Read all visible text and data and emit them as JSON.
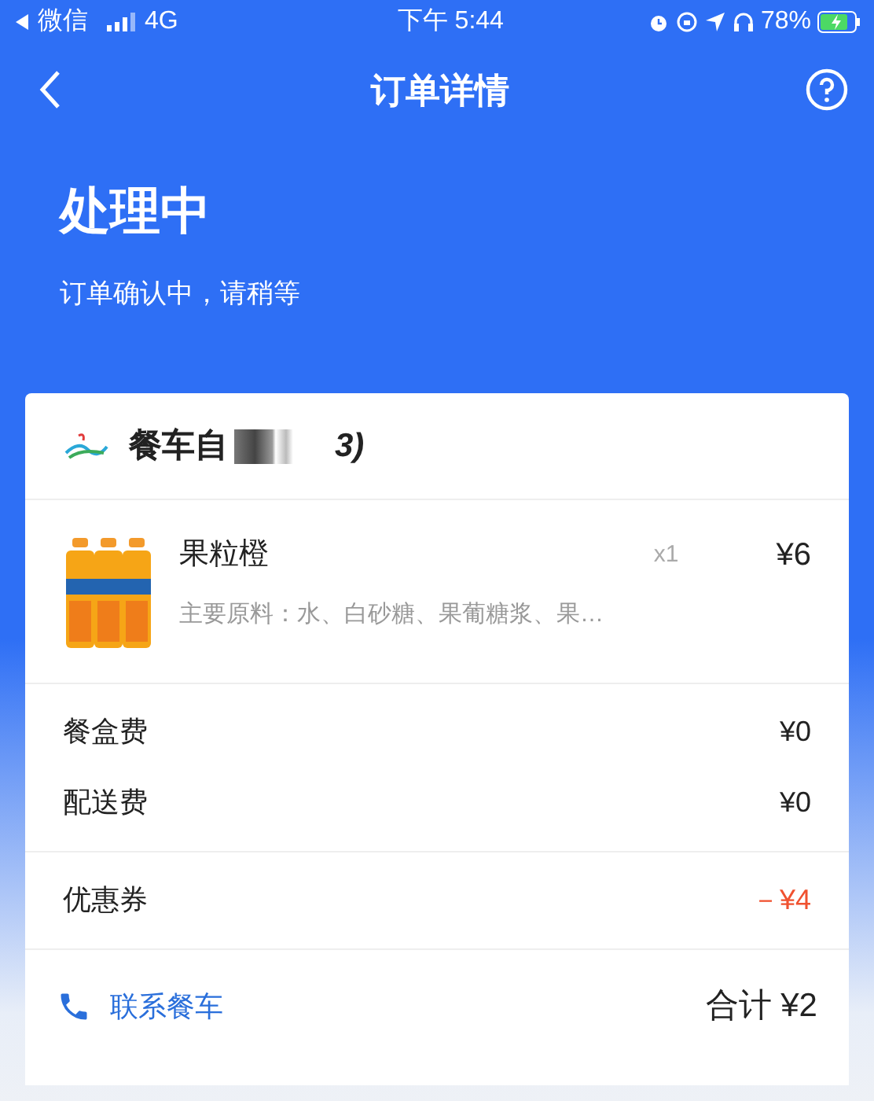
{
  "status_bar": {
    "back_app": "微信",
    "network": "4G",
    "time": "下午 5:44",
    "battery": "78%"
  },
  "nav": {
    "title": "订单详情"
  },
  "order_status": {
    "title": "处理中",
    "subtitle": "订单确认中，请稍等"
  },
  "store": {
    "name_start": "餐车自",
    "name_end": "3)"
  },
  "items": [
    {
      "name": "果粒橙",
      "description": "主要原料：水、白砂糖、果葡糖浆、果…",
      "quantity": "x1",
      "price": "¥6"
    }
  ],
  "fees": [
    {
      "label": "餐盒费",
      "amount": "¥0"
    },
    {
      "label": "配送费",
      "amount": "¥0"
    }
  ],
  "discounts": [
    {
      "label": "优惠券",
      "amount": "－¥4"
    }
  ],
  "footer": {
    "contact": "联系餐车",
    "total": "合计 ¥2"
  }
}
